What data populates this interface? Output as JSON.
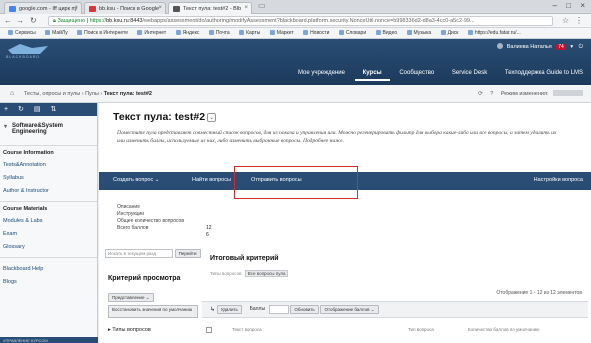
{
  "browser": {
    "tabs": [
      {
        "label": "google.com - Iff цирк пу",
        "color": "#4285f4",
        "active": false
      },
      {
        "label": "bb.ksu - Поиск в Google",
        "color": "#d33",
        "active": false
      },
      {
        "label": "Текст пула: test#2 - Blb",
        "color": "#555",
        "active": true
      }
    ],
    "url": {
      "secure_label": "Защищено",
      "scheme": "https://",
      "host": "bb.ksu.ru:8443",
      "path": "/webapps/assessment/do/authoring/modifyAssessment?blackboard.platform.security.NonceUtil.nonce=b998336d2-d8a3-4cc0-a5c2-99..."
    },
    "bookmarks": [
      "Сервисы",
      "МайЛу",
      "Поиск в Интернете",
      "Интернет",
      "Яндекс",
      "Почта",
      "Карты",
      "Маркет",
      "Новости",
      "Словари",
      "Видео",
      "Музыка",
      "Диск",
      "https://edu.fatar.ru/..."
    ]
  },
  "header": {
    "logo_caption": "BLACKBOARD",
    "user_name": "Валиева Наталья",
    "notify_count": "74",
    "nav": [
      {
        "label": "Мое учреждение",
        "active": false
      },
      {
        "label": "Курсы",
        "active": true
      },
      {
        "label": "Сообщество",
        "active": false
      },
      {
        "label": "Service Desk",
        "active": false
      },
      {
        "label": "Техподдержка Guide to LMS",
        "active": false
      }
    ]
  },
  "breadcrumb": {
    "items": [
      "Тесты, опросы и пулы",
      "Пулы",
      "Текст пула: test#2"
    ],
    "edit_mode_label": "Режим изменения:"
  },
  "sidebar": {
    "course_name": "Software&System Engineering",
    "sections": [
      {
        "header": "Course Information",
        "items": [
          "Tests&Annotation",
          "Syllabus",
          "Author & Instructor"
        ]
      },
      {
        "header": "Course Materials",
        "items": [
          "Modules & Labs",
          "Exam",
          "Glossary"
        ]
      },
      {
        "header": "",
        "items": [
          "Blackboard Help",
          "Blogs"
        ]
      }
    ],
    "footer": "УПРАВЛЕНИЕ КУРСОМ"
  },
  "main": {
    "title": "Текст пула: test#2",
    "description": "Поместите пула представляет совместный список вопросов, для из показа и управления или. Можно регенерировать фильтр для выбора какие-либо или все вопросы, а затем удалить их или изменить баллы, используемые из них, либо изменить выбранные вопросы. Подробнее ниже.",
    "actions": [
      "Создать вопрос",
      "Найти вопросы",
      "Отправить вопросы",
      "Настройки вопроса"
    ],
    "info": {
      "labels": [
        "Описание",
        "Инструкции",
        "Общее количество вопросов",
        "Всего баллов"
      ],
      "total_questions": "12",
      "total_points": "6"
    },
    "search": {
      "placeholder": "Искать в текущем разд",
      "button": "Перейти"
    },
    "criteria_title": "Критерий просмотра",
    "presentation_label": "Представление",
    "reset_label": "Восстановить значения по умолчанию",
    "question_types_label": "Типы вопросов",
    "result": {
      "title": "Итоговый критерий",
      "subtitle": "Типы вопросов",
      "tag": "Все вопросы пула",
      "count": "Отображение 1 - 12 из 12 элементов",
      "delete_label": "Удалить",
      "points_label": "Баллы",
      "update_label": "Обновить",
      "hide_points_label": "Отображение баллов",
      "columns": [
        "Текст вопроса",
        "Тип вопроса",
        "Количество баллов по умолчанию"
      ]
    }
  }
}
